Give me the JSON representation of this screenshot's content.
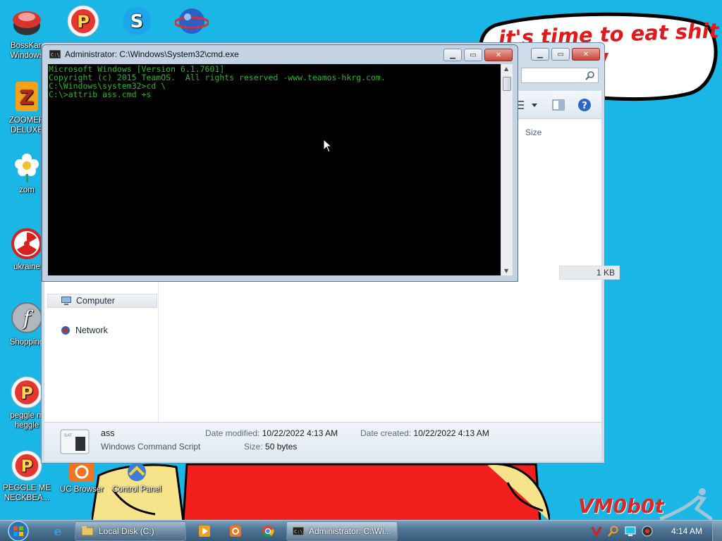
{
  "wallpaper": {
    "speech_text": "it's time to eat shit\nand chew\n  gum",
    "watermark": "VM0b0t"
  },
  "desktop_icons": [
    {
      "label1": "BossKan",
      "label2": "Windows",
      "icon": "boss-icon"
    },
    {
      "label1": "ZOOMER",
      "label2": "DELUXE",
      "icon": "zoomer-icon"
    },
    {
      "label1": "zom",
      "label2": "",
      "icon": "flower-icon"
    },
    {
      "label1": "ukraine",
      "label2": "",
      "icon": "radiation-icon"
    },
    {
      "label1": "Shopping",
      "label2": "",
      "icon": "flash-icon"
    },
    {
      "label1": "peggle m",
      "label2": "heggle",
      "icon": "peggle-icon"
    },
    {
      "label1": "PEGGLE ME",
      "label2": "NECKBEA...",
      "icon": "peggle-icon"
    },
    {
      "label1": "UC Browser",
      "label2": "",
      "icon": "uc-browser-icon"
    },
    {
      "label1": "Control Panel",
      "label2": "",
      "icon": "control-panel-icon"
    }
  ],
  "explorer": {
    "nav": {
      "computer": "Computer",
      "network": "Network"
    },
    "column_size": "Size",
    "row_size": "1 KB",
    "details": {
      "name": "ass",
      "type": "Windows Command Script",
      "modified_label": "Date modified:",
      "modified_value": "10/22/2022 4:13 AM",
      "created_label": "Date created:",
      "created_value": "10/22/2022 4:13 AM",
      "size_label": "Size:",
      "size_value": "50 bytes"
    }
  },
  "cmd": {
    "title": "Administrator: C:\\Windows\\System32\\cmd.exe",
    "lines": [
      "Microsoft Windows [Version 6.1.7601]",
      "Copyright (c) 2015 TeamOS.  All rights reserved -www.teamos-hkrg.com.",
      "",
      "C:\\Windows\\system32>cd \\",
      "",
      "C:\\>attrib ass.cmd +s"
    ]
  },
  "taskbar": {
    "local_disk": "Local Disk (C:)",
    "cmd_task": "Administrator: C:\\Wi...",
    "clock": "4:14 AM"
  },
  "colors": {
    "desktop": "#19b6e6",
    "console_text": "#2cb52c",
    "speech_text": "#e0191c"
  }
}
